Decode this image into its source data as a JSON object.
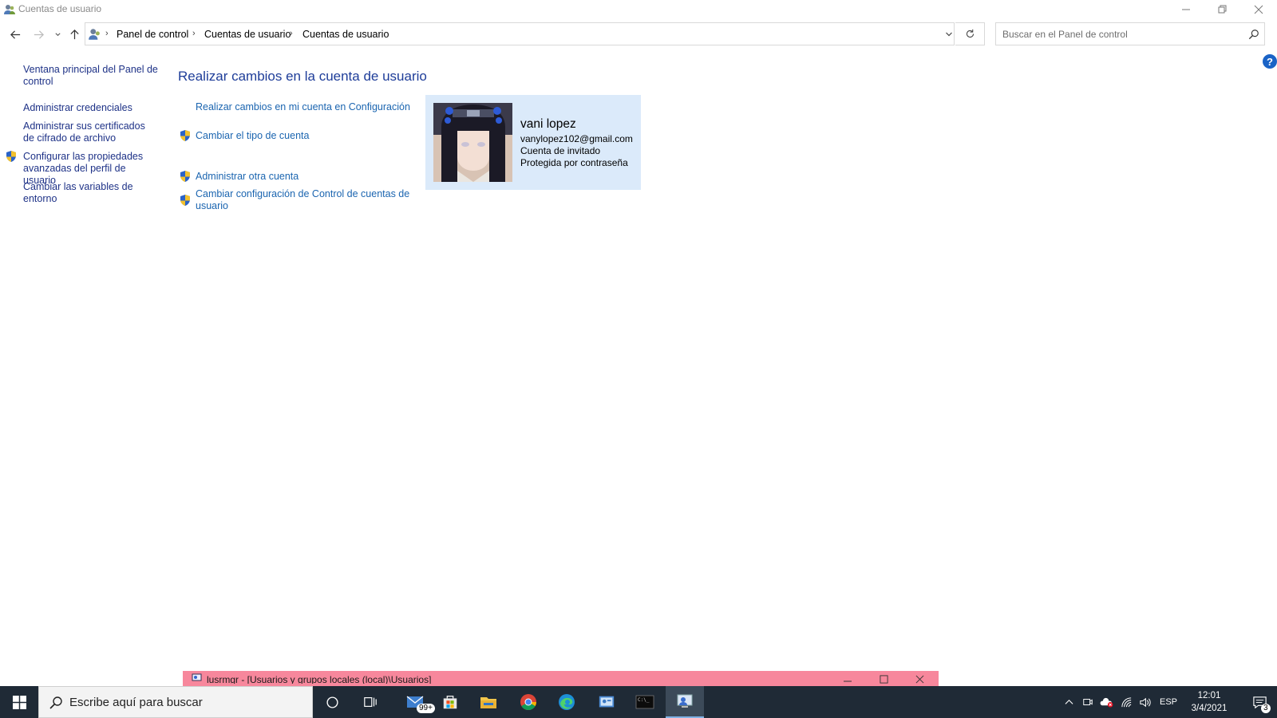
{
  "window": {
    "title": "Cuentas de usuario"
  },
  "breadcrumb": {
    "items": [
      "Panel de control",
      "Cuentas de usuario",
      "Cuentas de usuario"
    ]
  },
  "search": {
    "placeholder": "Buscar en el Panel de control"
  },
  "left_pane": {
    "links": [
      "Ventana principal del Panel de control",
      "Administrar credenciales",
      "Administrar sus certificados de cifrado de archivo",
      "Configurar las propiedades avanzadas del perfil de usuario",
      "Cambiar las variables de entorno"
    ]
  },
  "main": {
    "heading": "Realizar cambios en la cuenta de usuario",
    "tasks": [
      "Realizar cambios en mi cuenta en Configuración",
      "Cambiar el tipo de cuenta",
      "Administrar otra cuenta",
      "Cambiar configuración de Control de cuentas de usuario"
    ]
  },
  "account": {
    "name": "vani lopez",
    "email": "vanylopez102@gmail.com",
    "type": "Cuenta de invitado",
    "protection": "Protegida por contraseña"
  },
  "background_window": {
    "title": "lusrmgr - [Usuarios y grupos locales (local)\\Usuarios]"
  },
  "taskbar": {
    "search_placeholder": "Escribe aquí para buscar",
    "mail_badge": "99+",
    "language": "ESP",
    "time": "12:01",
    "date": "3/4/2021",
    "notification_count": "3"
  },
  "colors": {
    "link": "#1b65b0",
    "heading": "#1e3d99",
    "card_bg": "#dbeafa",
    "taskbar_bg": "#1f2a36",
    "bg_window_accent": "#f7879c"
  }
}
